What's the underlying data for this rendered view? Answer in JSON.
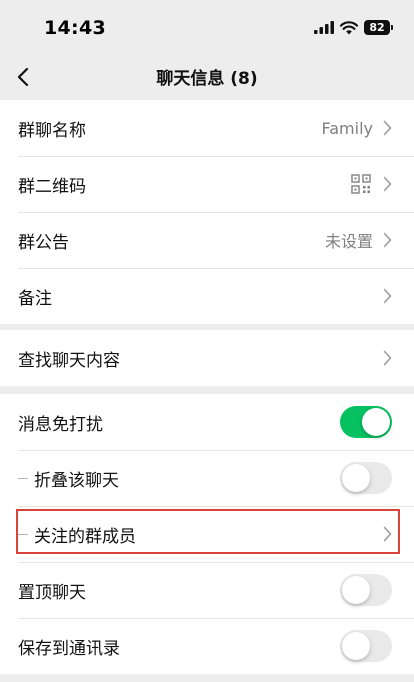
{
  "status_bar": {
    "time": "14:43",
    "battery": "82",
    "icons": [
      "signal-icon",
      "wifi-icon",
      "battery-icon"
    ]
  },
  "nav": {
    "title": "聊天信息 (8)",
    "back_icon": "chevron-left-icon"
  },
  "group1": [
    {
      "label": "群聊名称",
      "value": "Family",
      "accessory": "chevron"
    },
    {
      "label": "群二维码",
      "value": "",
      "accessory": "qr-code-icon"
    },
    {
      "label": "群公告",
      "value": "未设置",
      "accessory": "chevron"
    },
    {
      "label": "备注",
      "value": "",
      "accessory": "chevron"
    }
  ],
  "group2": [
    {
      "label": "查找聊天内容",
      "accessory": "chevron"
    }
  ],
  "group3": [
    {
      "label": "消息免打扰",
      "accessory": "toggle",
      "on": true
    },
    {
      "label": "折叠该聊天",
      "accessory": "toggle",
      "on": false,
      "sub": true
    },
    {
      "label": "关注的群成员",
      "accessory": "chevron",
      "sub": true,
      "highlighted": true
    },
    {
      "label": "置顶聊天",
      "accessory": "toggle",
      "on": false
    },
    {
      "label": "保存到通讯录",
      "accessory": "toggle",
      "on": false
    }
  ],
  "colors": {
    "background": "#ededed",
    "toggle_on": "#07c160",
    "toggle_off": "#e9e9ea",
    "highlight": "#d9443a",
    "secondary_text": "#7f7f7f"
  }
}
